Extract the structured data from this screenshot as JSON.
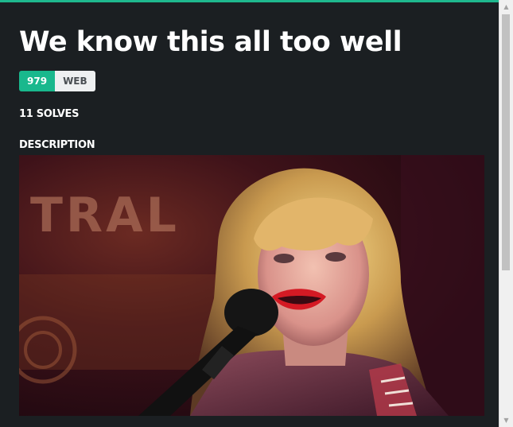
{
  "challenge": {
    "title": "We know this all too well",
    "points": "979",
    "category": "WEB",
    "solves": "11 SOLVES",
    "description_heading": "DESCRIPTION"
  },
  "image": {
    "sign_text": "TRAL"
  },
  "colors": {
    "accent": "#1fb88e",
    "points_badge": "#19b88d",
    "category_badge": "#eef0f1",
    "modal_background": "#1b1f22"
  },
  "icons": {
    "scroll_up": "triangle-up-icon",
    "scroll_down": "triangle-down-icon"
  }
}
